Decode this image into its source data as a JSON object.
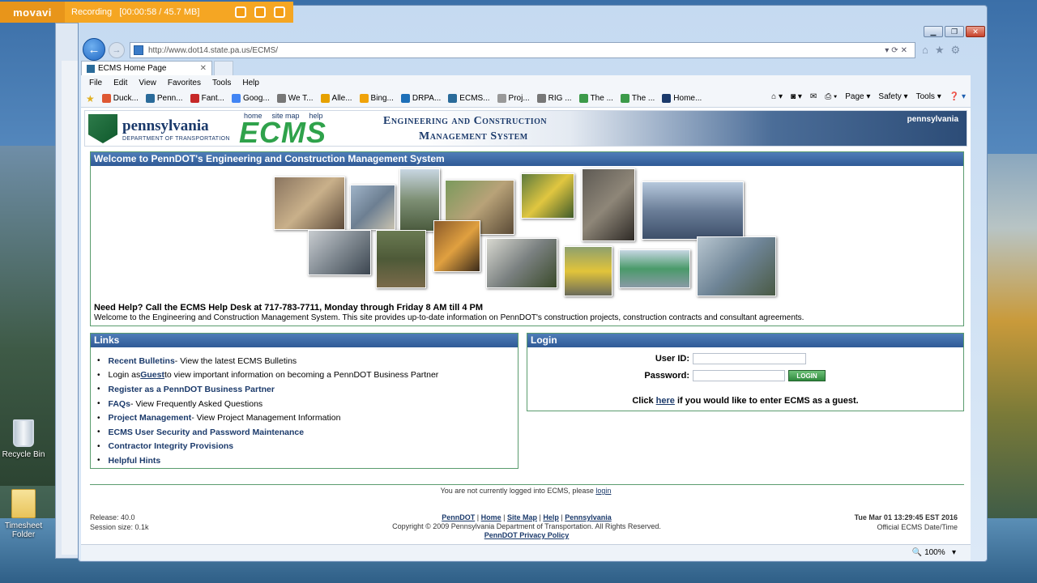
{
  "recorder": {
    "brand": "movavi",
    "status": "Recording",
    "time": "[00:00:58 / 45.7 MB]"
  },
  "desktop": {
    "icons": [
      {
        "label": "Recycle Bin"
      },
      {
        "label": "Timesheet Folder"
      }
    ]
  },
  "browser": {
    "url": "http://www.dot14.state.pa.us/ECMS/",
    "tab_title": "ECMS Home Page",
    "menu": [
      "File",
      "Edit",
      "View",
      "Favorites",
      "Tools",
      "Help"
    ],
    "favorites": [
      "Duck...",
      "Penn...",
      "Fant...",
      "Goog...",
      "We T...",
      "Alle...",
      "Bing...",
      "DRPA...",
      "ECMS...",
      "Proj...",
      "RIG ...",
      "The ...",
      "The ...",
      "Home..."
    ],
    "commands": [
      "Page",
      "Safety",
      "Tools"
    ],
    "zoom": "100%"
  },
  "header": {
    "pa": "pennsylvania",
    "dept": "DEPARTMENT OF TRANSPORTATION",
    "links": [
      "home",
      "site map",
      "help"
    ],
    "logo": "ECMS",
    "title1": "Engineering and Construction",
    "title2": "Management System",
    "brand": "pennsylvania"
  },
  "welcome": {
    "title": "Welcome to PennDOT's Engineering and Construction Management System",
    "help": "Need Help? Call the ECMS Help Desk at 717-783-7711, Monday through Friday 8 AM till 4 PM",
    "intro": "Welcome to the Engineering and Construction Management System. This site provides up-to-date information on PennDOT's construction projects, construction contracts and consultant agreements."
  },
  "links": {
    "title": "Links",
    "items": [
      {
        "label": "Recent Bulletins",
        "desc": " - View the latest ECMS Bulletins"
      },
      {
        "pre": "Login as ",
        "label": "Guest",
        "desc": " to view important information on becoming a PennDOT Business Partner"
      },
      {
        "label": "Register as a PennDOT Business Partner",
        "desc": ""
      },
      {
        "label": "FAQs",
        "desc": " - View Frequently Asked Questions"
      },
      {
        "label": "Project Management",
        "desc": " - View Project Management Information"
      },
      {
        "label": "ECMS User Security and Password Maintenance",
        "desc": ""
      },
      {
        "label": "Contractor Integrity Provisions",
        "desc": ""
      },
      {
        "label": "Helpful Hints",
        "desc": ""
      }
    ]
  },
  "login": {
    "title": "Login",
    "user_label": "User ID:",
    "pass_label": "Password:",
    "button": "LOGIN",
    "guest_pre": "Click ",
    "guest_link": "here",
    "guest_post": " if you would like to enter ECMS as a guest."
  },
  "footer": {
    "notlogged": "You are not currently logged into ECMS, please ",
    "login_link": "login",
    "release": "Release: 40.0",
    "session": "Session size: 0.1k",
    "links": [
      "PennDOT",
      "Home",
      "Site Map",
      "Help",
      "Pennsylvania"
    ],
    "copyright": "Copyright © 2009 Pennsylvania Department of Transportation. All Rights Reserved.",
    "privacy": "PennDOT Privacy Policy",
    "date": "Tue Mar 01 13:29:45 EST 2016",
    "date_label": "Official ECMS Date/Time"
  }
}
